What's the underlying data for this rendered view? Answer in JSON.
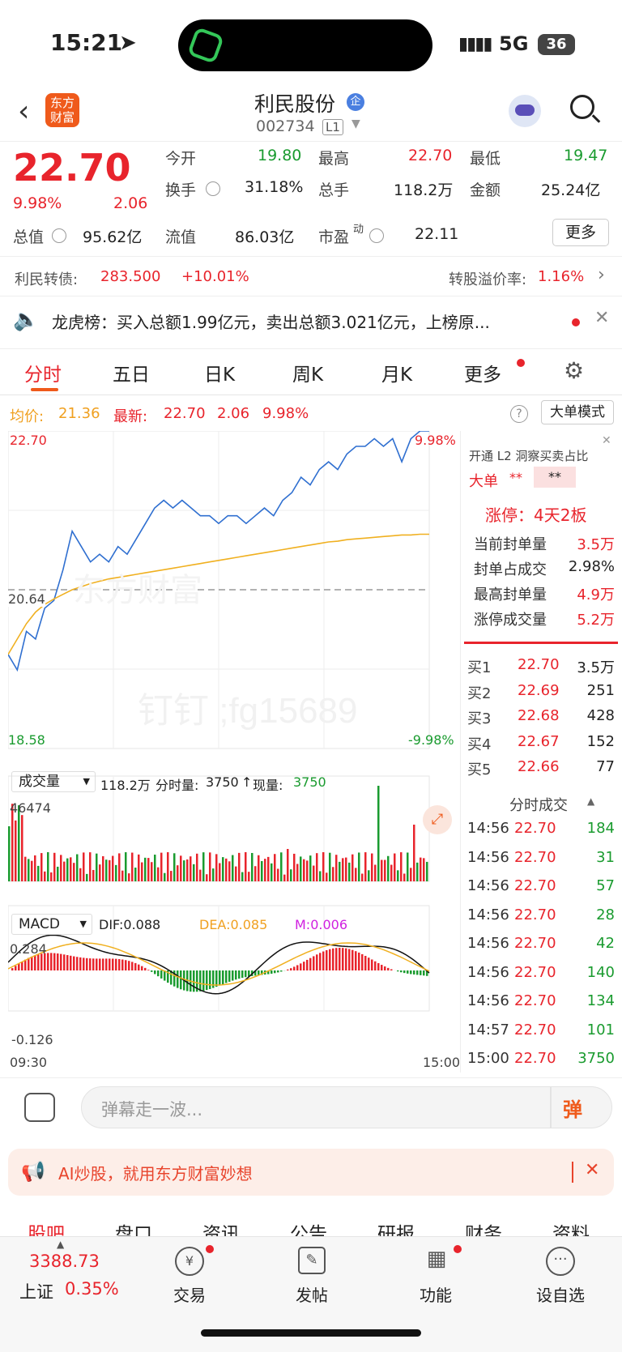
{
  "status_bar": {
    "time": "15:21",
    "network": "5G",
    "battery": "36"
  },
  "header": {
    "app_logo": "东方\n财富",
    "title": "利民股份",
    "badge": "企",
    "code": "002734",
    "level": "L1"
  },
  "quote": {
    "price": "22.70",
    "pct": "9.98%",
    "change": "2.06",
    "fields": [
      {
        "k": "今开",
        "v": "19.80",
        "c": "green"
      },
      {
        "k": "最高",
        "v": "22.70",
        "c": "red"
      },
      {
        "k": "最低",
        "v": "19.47",
        "c": "green"
      },
      {
        "k": "换手",
        "v": "31.18%",
        "c": "dark"
      },
      {
        "k": "总手",
        "v": "118.2万",
        "c": "dark"
      },
      {
        "k": "金额",
        "v": "25.24亿",
        "c": "dark"
      },
      {
        "k": "总值",
        "v": "95.62亿",
        "c": "dark"
      },
      {
        "k": "流值",
        "v": "86.03亿",
        "c": "dark"
      },
      {
        "k": "市盈",
        "v": "22.11",
        "c": "dark"
      }
    ],
    "pe_sup": "动",
    "more": "更多"
  },
  "bond": {
    "label": "利民转债:",
    "price": "283.500",
    "pct": "+10.01%",
    "premium_label": "转股溢价率:",
    "premium": "1.16%"
  },
  "dragon": {
    "text": "龙虎榜：买入总额1.99亿元，卖出总额3.021亿元，上榜原..."
  },
  "tabs": [
    "分时",
    "五日",
    "日K",
    "周K",
    "月K",
    "更多"
  ],
  "avg": {
    "avg_label": "均价:",
    "avg": "21.36",
    "new_label": "最新:",
    "new": "22.70",
    "chg": "2.06",
    "pct": "9.98%",
    "mode": "大单模式"
  },
  "chart_data": {
    "type": "line",
    "title": "",
    "y_top": "22.70",
    "y_mid": "20.64",
    "y_bot": "18.58",
    "pct_top": "9.98%",
    "pct_bot": "-9.98%",
    "x_start": "09:30",
    "x_end": "15:00",
    "ylim": [
      18.58,
      22.7
    ],
    "series": [
      {
        "name": "price",
        "values": [
          19.8,
          19.6,
          20.1,
          20.0,
          20.4,
          20.5,
          20.9,
          21.4,
          21.2,
          21.0,
          21.1,
          21.0,
          21.2,
          21.1,
          21.3,
          21.5,
          21.7,
          21.8,
          21.7,
          21.8,
          21.7,
          21.6,
          21.6,
          21.5,
          21.6,
          21.6,
          21.5,
          21.6,
          21.7,
          21.6,
          21.8,
          21.9,
          22.1,
          22.0,
          22.2,
          22.3,
          22.2,
          22.4,
          22.5,
          22.5,
          22.6,
          22.5,
          22.6,
          22.3,
          22.6,
          22.7,
          22.7
        ]
      },
      {
        "name": "avg",
        "values": [
          19.8,
          20.0,
          20.2,
          20.35,
          20.45,
          20.52,
          20.58,
          20.64,
          20.68,
          20.72,
          20.75,
          20.78,
          20.8,
          20.82,
          20.84,
          20.86,
          20.88,
          20.9,
          20.92,
          20.94,
          20.96,
          20.98,
          21.0,
          21.02,
          21.04,
          21.06,
          21.08,
          21.1,
          21.12,
          21.14,
          21.16,
          21.18,
          21.2,
          21.22,
          21.24,
          21.26,
          21.27,
          21.29,
          21.3,
          21.31,
          21.32,
          21.33,
          21.34,
          21.35,
          21.35,
          21.36,
          21.36
        ]
      }
    ],
    "volume": {
      "label": "成交量",
      "total": "118.2万",
      "split_label": "分时量:",
      "split": "3750",
      "now_label": "现量:",
      "now": "3750",
      "max": "46474"
    },
    "macd": {
      "label": "MACD",
      "dif": "DIF:0.088",
      "dea": "DEA:0.085",
      "m": "M:0.006",
      "top": "0.284",
      "bot": "-0.126"
    }
  },
  "side": {
    "l2": "开通 L2 洞察买卖占比",
    "big_label": "大单",
    "big_v1": "**",
    "big_v2": "**",
    "limit_title": "涨停：4天2板",
    "limit_rows": [
      {
        "k": "当前封单量",
        "v": "3.5万",
        "c": "red"
      },
      {
        "k": "封单占成交",
        "v": "2.98%",
        "c": "dark"
      },
      {
        "k": "最高封单量",
        "v": "4.9万",
        "c": "red"
      },
      {
        "k": "涨停成交量",
        "v": "5.2万",
        "c": "red"
      }
    ],
    "bids": [
      {
        "k": "买1",
        "p": "22.70",
        "v": "3.5万"
      },
      {
        "k": "买2",
        "p": "22.69",
        "v": "251"
      },
      {
        "k": "买3",
        "p": "22.68",
        "v": "428"
      },
      {
        "k": "买4",
        "p": "22.67",
        "v": "152"
      },
      {
        "k": "买5",
        "p": "22.66",
        "v": "77"
      }
    ],
    "ticks_title": "分时成交",
    "ticks": [
      {
        "t": "14:56",
        "p": "22.70",
        "v": "184"
      },
      {
        "t": "14:56",
        "p": "22.70",
        "v": "31"
      },
      {
        "t": "14:56",
        "p": "22.70",
        "v": "57"
      },
      {
        "t": "14:56",
        "p": "22.70",
        "v": "28"
      },
      {
        "t": "14:56",
        "p": "22.70",
        "v": "42"
      },
      {
        "t": "14:56",
        "p": "22.70",
        "v": "140"
      },
      {
        "t": "14:56",
        "p": "22.70",
        "v": "134"
      },
      {
        "t": "14:57",
        "p": "22.70",
        "v": "101"
      },
      {
        "t": "15:00",
        "p": "22.70",
        "v": "3750"
      }
    ]
  },
  "comment": {
    "placeholder": "弹幕走一波...",
    "btn": "弹"
  },
  "ai": {
    "text": "AI炒股，就用东方财富妙想"
  },
  "subtabs": [
    "股吧",
    "盘口",
    "资讯",
    "公告",
    "研报",
    "财务",
    "资料"
  ],
  "nav": {
    "index": "3388.73",
    "index_name": "上证",
    "index_pct": "0.35%",
    "items": [
      "交易",
      "发帖",
      "功能",
      "设自选"
    ]
  },
  "colors": {
    "red": "#e8242c",
    "green": "#1a9b2f",
    "blue": "#2f6fd0",
    "avg": "#f0b020",
    "brand": "#ef5a1b"
  },
  "watermark": {
    "text1": "东方财富",
    "text2": "钉钉 ;fg15689"
  }
}
